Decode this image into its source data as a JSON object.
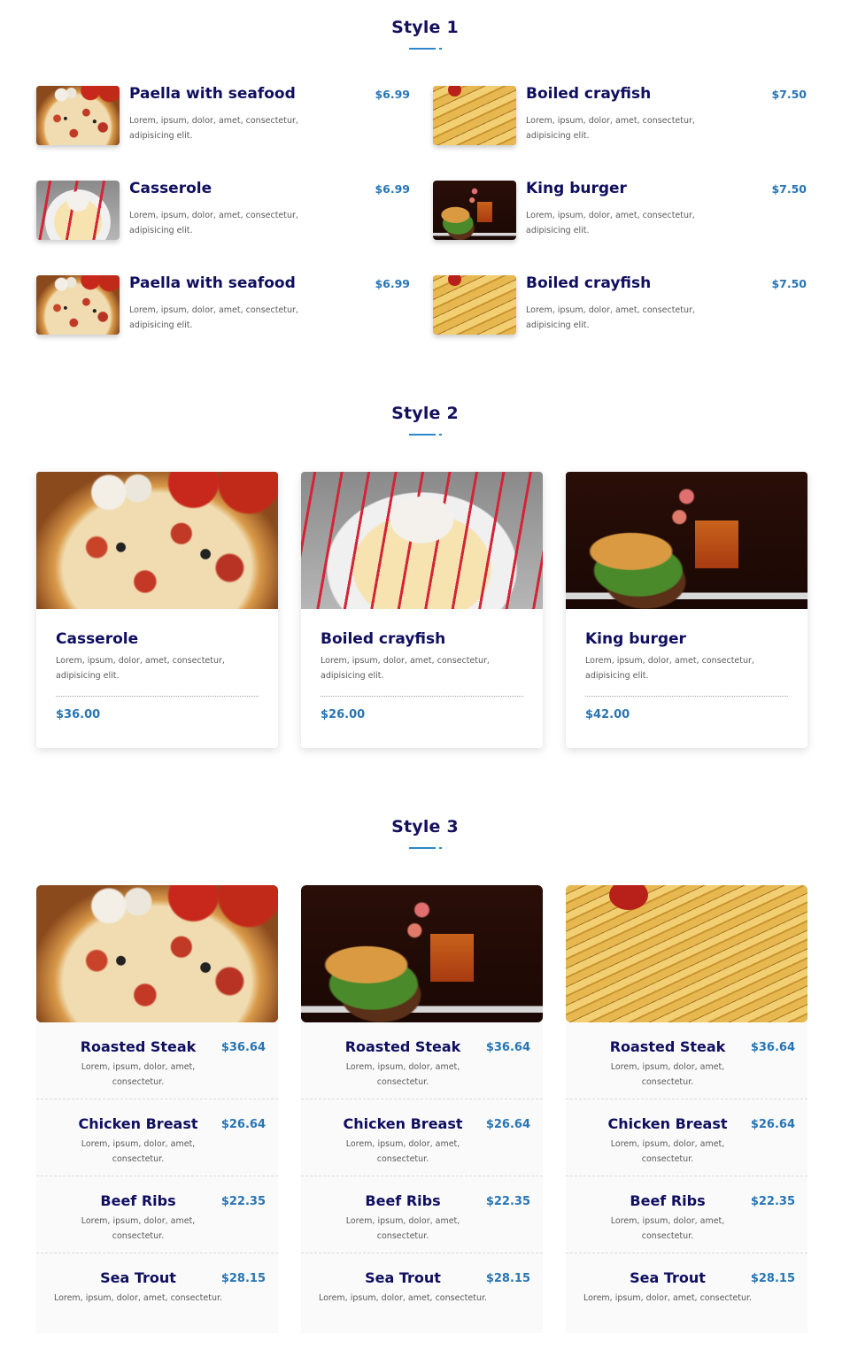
{
  "colors": {
    "heading": "#0f0e5f",
    "price": "#2775b5",
    "accent_line": "#2d86c9",
    "text": "#5a5a5a"
  },
  "style1": {
    "title": "Style 1",
    "items": [
      {
        "name": "Paella with seafood",
        "price": "$6.99",
        "desc": "Lorem, ipsum, dolor, amet, consectetur, adipisicing elit.",
        "image": "pizza"
      },
      {
        "name": "Boiled crayfish",
        "price": "$7.50",
        "desc": "Lorem, ipsum, dolor, amet, consectetur, adipisicing elit.",
        "image": "fries"
      },
      {
        "name": "Casserole",
        "price": "$6.99",
        "desc": "Lorem, ipsum, dolor, amet, consectetur, adipisicing elit.",
        "image": "dessert"
      },
      {
        "name": "King burger",
        "price": "$7.50",
        "desc": "Lorem, ipsum, dolor, amet, consectetur, adipisicing elit.",
        "image": "burger"
      },
      {
        "name": "Paella with seafood",
        "price": "$6.99",
        "desc": "Lorem, ipsum, dolor, amet, consectetur, adipisicing elit.",
        "image": "pizza"
      },
      {
        "name": "Boiled crayfish",
        "price": "$7.50",
        "desc": "Lorem, ipsum, dolor, amet, consectetur, adipisicing elit.",
        "image": "fries"
      }
    ]
  },
  "style2": {
    "title": "Style 2",
    "cards": [
      {
        "name": "Casserole",
        "desc": "Lorem, ipsum, dolor, amet, consectetur, adipisicing elit.",
        "price": "$36.00",
        "image": "pizza"
      },
      {
        "name": "Boiled crayfish",
        "desc": "Lorem, ipsum, dolor, amet, consectetur, adipisicing elit.",
        "price": "$26.00",
        "image": "dessert"
      },
      {
        "name": "King burger",
        "desc": "Lorem, ipsum, dolor, amet, consectetur, adipisicing elit.",
        "price": "$42.00",
        "image": "burger"
      }
    ]
  },
  "style3": {
    "title": "Style 3",
    "columns": [
      {
        "image": "pizza",
        "items": [
          {
            "name": "Roasted Steak",
            "price": "$36.64",
            "desc": "Lorem, ipsum, dolor, amet, consectetur."
          },
          {
            "name": "Chicken Breast",
            "price": "$26.64",
            "desc": "Lorem, ipsum, dolor, amet, consectetur."
          },
          {
            "name": "Beef Ribs",
            "price": "$22.35",
            "desc": "Lorem, ipsum, dolor, amet, consectetur."
          },
          {
            "name": "Sea Trout",
            "price": "$28.15",
            "desc": "Lorem, ipsum, dolor, amet, consectetur."
          }
        ]
      },
      {
        "image": "burger",
        "items": [
          {
            "name": "Roasted Steak",
            "price": "$36.64",
            "desc": "Lorem, ipsum, dolor, amet, consectetur."
          },
          {
            "name": "Chicken Breast",
            "price": "$26.64",
            "desc": "Lorem, ipsum, dolor, amet, consectetur."
          },
          {
            "name": "Beef Ribs",
            "price": "$22.35",
            "desc": "Lorem, ipsum, dolor, amet, consectetur."
          },
          {
            "name": "Sea Trout",
            "price": "$28.15",
            "desc": "Lorem, ipsum, dolor, amet, consectetur."
          }
        ]
      },
      {
        "image": "fries",
        "items": [
          {
            "name": "Roasted Steak",
            "price": "$36.64",
            "desc": "Lorem, ipsum, dolor, amet, consectetur."
          },
          {
            "name": "Chicken Breast",
            "price": "$26.64",
            "desc": "Lorem, ipsum, dolor, amet, consectetur."
          },
          {
            "name": "Beef Ribs",
            "price": "$22.35",
            "desc": "Lorem, ipsum, dolor, amet, consectetur."
          },
          {
            "name": "Sea Trout",
            "price": "$28.15",
            "desc": "Lorem, ipsum, dolor, amet, consectetur."
          }
        ]
      }
    ]
  }
}
